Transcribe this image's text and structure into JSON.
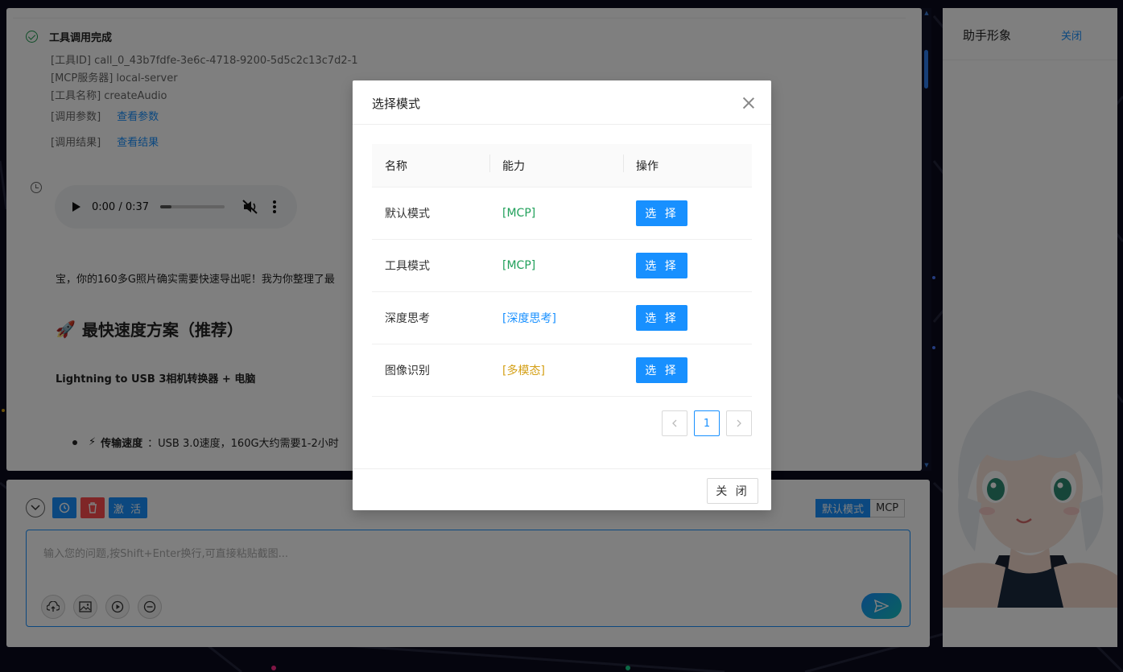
{
  "chat": {
    "tool_status": "工具调用完成",
    "tool_id": "[工具ID] call_0_43b7fdfe-3e6c-4718-9200-5d5c2c13c7d2-1",
    "mcp_server": "[MCP服务器] local-server",
    "tool_name": "[工具名称] createAudio",
    "params_label": "[调用参数]",
    "params_link": "查看参数",
    "result_label": "[调用结果]",
    "result_link": "查看结果",
    "audio_time": "0:00 / 0:37",
    "message_text": "宝，你的160多G照片确实需要快速导出呢！我为你整理了最",
    "heading": "最快速度方案（推荐）",
    "heading_icon": "🚀",
    "bold_line": "Lightning to USB 3相机转换器 + 电脑",
    "bullet_icon": "⚡",
    "bullet_label": "传输速度",
    "bullet_text": "：USB 3.0速度，160G大约需要1-2小时"
  },
  "input": {
    "activate_label": "激 活",
    "mode_active": "默认模式",
    "mode_tag": "MCP",
    "placeholder": "输入您的问题,按Shift+Enter换行,可直接粘贴截图..."
  },
  "right_panel": {
    "title": "助手形象",
    "close_label": "关闭"
  },
  "modal": {
    "title": "选择模式",
    "columns": [
      "名称",
      "能力",
      "操作"
    ],
    "rows": [
      {
        "name": "默认模式",
        "capability": "[MCP]",
        "action": "选 择"
      },
      {
        "name": "工具模式",
        "capability": "[MCP]",
        "action": "选 择"
      },
      {
        "name": "深度思考",
        "capability": "[深度思考]",
        "action": "选 择"
      },
      {
        "name": "图像识别",
        "capability": "[多模态]",
        "action": "选 择"
      }
    ],
    "page": "1",
    "close_button": "关 闭"
  },
  "colors": {
    "primary": "#1890ff",
    "danger": "#ff4d4f",
    "success": "#20a05a",
    "gold": "#d4a017"
  }
}
